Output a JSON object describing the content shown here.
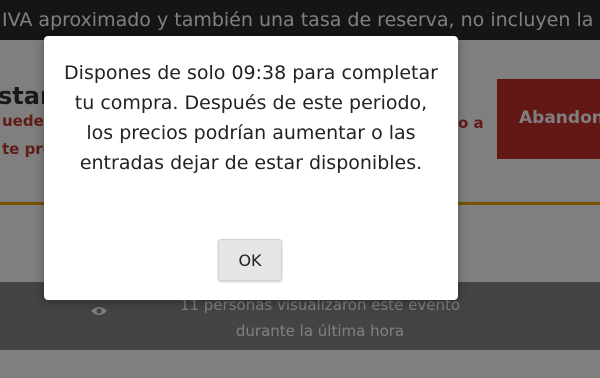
{
  "background_page": {
    "banner_text": "IVA aproximado y también una tasa de reserva, no incluyen la tasa",
    "heading_partial": "stant",
    "red_text_left_1": "uede",
    "red_text_left_2": "te pre",
    "red_text_right": "o a",
    "abandon_label": "Abandona",
    "viewers_line_1": "11 personas visualizaron este evento",
    "viewers_line_2": "durante la última hora"
  },
  "modal": {
    "message": "Dispones de solo 09:38 para completar tu compra. Después de este periodo, los precios podrían aumentar o las entradas dejar de estar disponibles.",
    "ok_label": "OK"
  },
  "colors": {
    "banner_bg": "#2b2b2b",
    "abandon_bg": "#c9312c",
    "accent_line": "#f0a500",
    "overlay": "rgba(0,0,0,0.5)"
  }
}
